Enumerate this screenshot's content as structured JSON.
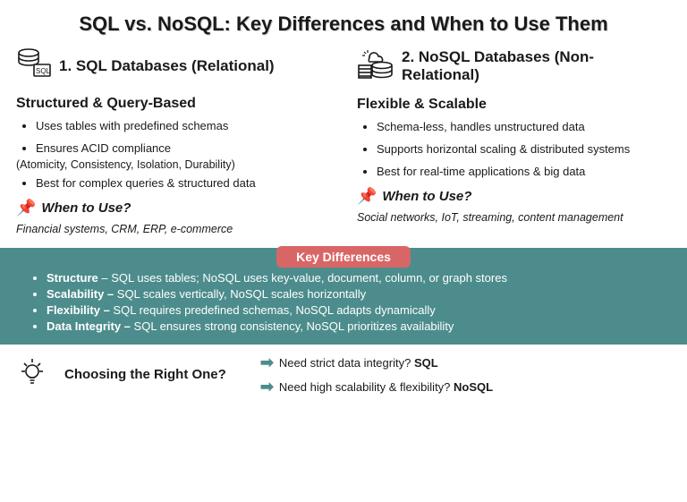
{
  "title": "SQL vs. NoSQL: Key Differences and When to Use Them",
  "sql": {
    "heading": "1. SQL Databases (Relational)",
    "subhead": "Structured & Query-Based",
    "bullets": [
      "Uses tables with predefined schemas",
      "Ensures ACID compliance",
      "Best for complex queries & structured data"
    ],
    "acid_note": "(Atomicity, Consistency, Isolation, Durability)",
    "when_label": "When to Use?",
    "examples": "Financial systems, CRM, ERP, e-commerce"
  },
  "nosql": {
    "heading": "2. NoSQL Databases (Non-Relational)",
    "subhead": "Flexible & Scalable",
    "bullets": [
      "Schema-less, handles unstructured data",
      "Supports horizontal scaling & distributed systems",
      "Best for real-time applications & big data"
    ],
    "when_label": "When to Use?",
    "examples": "Social networks, IoT, streaming, content management"
  },
  "keydiff": {
    "badge": "Key Differences",
    "items": [
      {
        "term": "Structure",
        "desc": " – SQL uses tables; NoSQL uses key-value, document, column, or graph stores"
      },
      {
        "term": "Scalability –",
        "desc": " SQL scales vertically, NoSQL scales horizontally"
      },
      {
        "term": "Flexibility –",
        "desc": " SQL requires predefined schemas, NoSQL adapts dynamically"
      },
      {
        "term": "Data Integrity –",
        "desc": " SQL ensures strong consistency, NoSQL prioritizes availability"
      }
    ]
  },
  "choose": {
    "label": "Choosing the Right One?",
    "c1_pre": "Need strict data integrity? ",
    "c1_b": "SQL",
    "c2_pre": "Need high scalability & flexibility? ",
    "c2_b": "NoSQL"
  }
}
